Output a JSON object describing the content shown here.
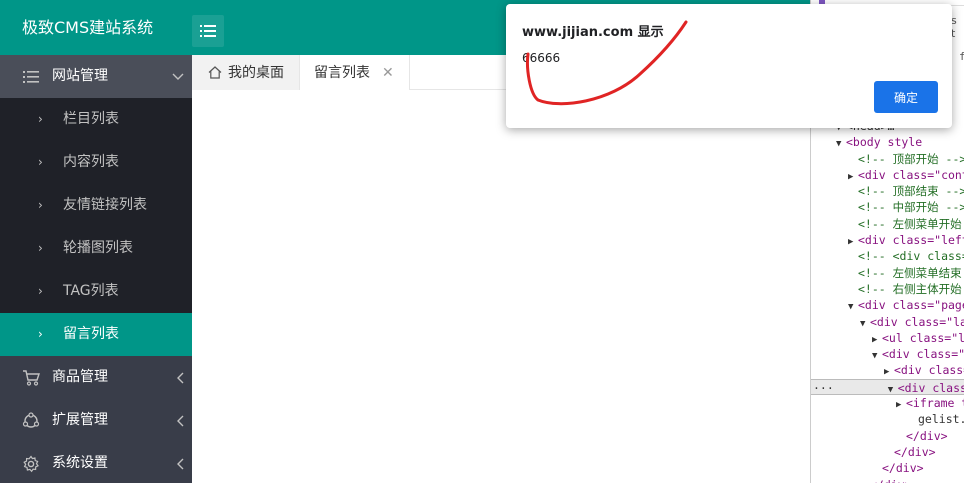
{
  "app": {
    "title": "极致CMS建站系统"
  },
  "sidebar": {
    "groups": [
      {
        "label": "网站管理",
        "icon": "list-icon",
        "state": "expanded"
      },
      {
        "label": "商品管理",
        "icon": "cart-icon",
        "state": "collapsed"
      },
      {
        "label": "扩展管理",
        "icon": "extension-icon",
        "state": "collapsed"
      },
      {
        "label": "系统设置",
        "icon": "gear-icon",
        "state": "collapsed"
      }
    ],
    "children": [
      {
        "label": "栏目列表"
      },
      {
        "label": "内容列表"
      },
      {
        "label": "友情链接列表"
      },
      {
        "label": "轮播图列表"
      },
      {
        "label": "TAG列表"
      },
      {
        "label": "留言列表",
        "active": true
      }
    ]
  },
  "tabs": {
    "home_label": "我的桌面",
    "current_label": "留言列表",
    "close_symbol": "✕"
  },
  "dialog": {
    "title": "www.jijian.com 显示",
    "message": "66666",
    "ok_label": "确定"
  },
  "devtools": {
    "side_text": "s t",
    "side_text2": "f",
    "lines": [
      {
        "indent": 0,
        "tri": "▼",
        "html": "<span class='tag'>&lt;head&gt;</span>…</span>",
        "text": "▼<head>…"
      },
      {
        "indent": 0,
        "tri": "▼",
        "text": "<body style"
      },
      {
        "indent": 1,
        "tri": "",
        "text": "<!-- 顶部开始 -->"
      },
      {
        "indent": 1,
        "tri": "▶",
        "text": "<div class=\"conta"
      },
      {
        "indent": 1,
        "tri": "",
        "text": "<!-- 顶部结束 -->"
      },
      {
        "indent": 1,
        "tri": "",
        "text": "<!-- 中部开始 -->"
      },
      {
        "indent": 1,
        "tri": "",
        "text": "<!-- 左侧菜单开始"
      },
      {
        "indent": 1,
        "tri": "▶",
        "text": "<div class=\"left"
      },
      {
        "indent": 1,
        "tri": "",
        "text": "<!-- <div class=\""
      },
      {
        "indent": 1,
        "tri": "",
        "text": "<!-- 左侧菜单结束"
      },
      {
        "indent": 1,
        "tri": "",
        "text": "<!-- 右侧主体开始"
      },
      {
        "indent": 1,
        "tri": "▼",
        "text": "<div class=\"page"
      },
      {
        "indent": 2,
        "tri": "▼",
        "text": "<div class=\"lay"
      },
      {
        "indent": 3,
        "tri": "▶",
        "text": "<ul class=\"la"
      },
      {
        "indent": 3,
        "tri": "▼",
        "text": "<div class=\"l"
      },
      {
        "indent": 4,
        "tri": "▶",
        "text": "<div class="
      },
      {
        "indent": 4,
        "tri": "▼",
        "text": "<div class=",
        "selected": true
      },
      {
        "indent": 5,
        "tri": "▶",
        "text": "<iframe t"
      },
      {
        "indent": 6,
        "tri": "",
        "text": "gelist.ht"
      },
      {
        "indent": 5,
        "tri": "",
        "text": "</div>"
      },
      {
        "indent": 4,
        "tri": "",
        "text": "</div>"
      },
      {
        "indent": 3,
        "tri": "",
        "text": "</div>"
      },
      {
        "indent": 2,
        "tri": "",
        "text": "</div>"
      }
    ]
  },
  "colors": {
    "header": "#009688",
    "sidebar": "#393d49",
    "sidebar_child": "#1f2128",
    "active": "#009688",
    "dialog_button": "#1a73e8",
    "annotation": "#e02424"
  }
}
